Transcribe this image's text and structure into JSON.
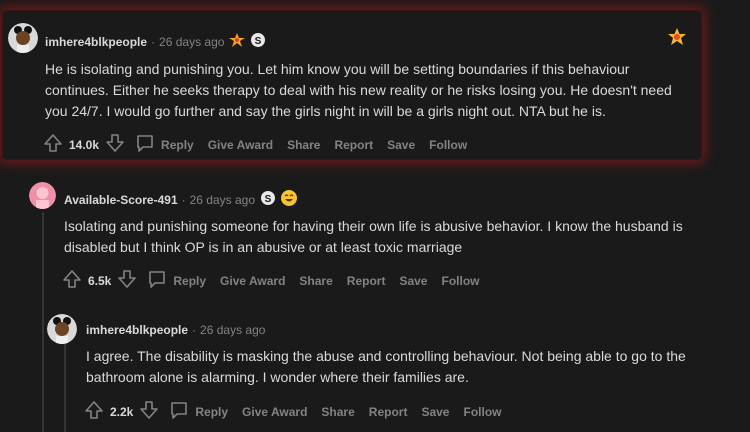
{
  "comments": [
    {
      "username": "imhere4blkpeople",
      "separator": "·",
      "time": "26 days ago",
      "body": "He is isolating and punishing you. Let him know you will be setting boundaries if this behaviour continues. Either he seeks therapy to deal with his new reality or he risks losing you. He doesn't need you 24/7. I would go further and say the girls night in will be a girls night out. NTA but he is.",
      "votes": "14.0k",
      "actions": [
        "Reply",
        "Give Award",
        "Share",
        "Report",
        "Save",
        "Follow"
      ],
      "awards": [
        "award-burst-icon",
        "silver-award-icon"
      ]
    },
    {
      "username": "Available-Score-491",
      "separator": "·",
      "time": "26 days ago",
      "body": "Isolating and punishing someone for having their own life is abusive behavior. I know the husband is disabled but I think OP is in an abusive or at least toxic marriage",
      "votes": "6.5k",
      "actions": [
        "Reply",
        "Give Award",
        "Share",
        "Report",
        "Save",
        "Follow"
      ],
      "awards": [
        "silver-award-icon",
        "laughing-face-award-icon"
      ]
    },
    {
      "username": "imhere4blkpeople",
      "separator": "·",
      "time": "26 days ago",
      "body": "I agree. The disability is masking the abuse and controlling behaviour. Not being able to go to the bathroom alone is alarming. I wonder where their families are.",
      "votes": "2.2k",
      "actions": [
        "Reply",
        "Give Award",
        "Share",
        "Report",
        "Save",
        "Follow"
      ]
    }
  ],
  "colors": {
    "background": "#1a1a1b",
    "text": "#d7dadc",
    "meta": "#818384",
    "highlight_glow": "#aa1919"
  }
}
